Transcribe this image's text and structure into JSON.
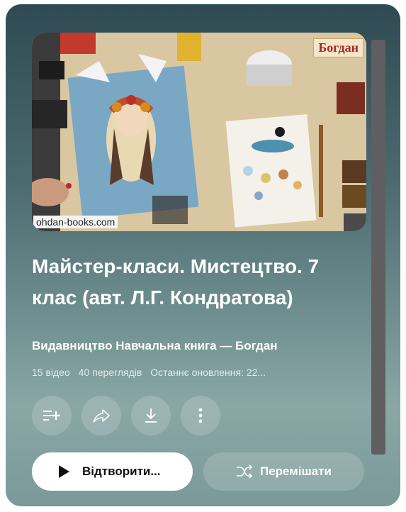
{
  "thumbnail": {
    "watermark": "ohdan-books.com",
    "logo_text": "Богдан"
  },
  "playlist": {
    "title": "Майстер-класи. Мистецтво. 7 клас (авт. Л.Г. Кондратова)",
    "channel": "Видавництво Навчальна книга — Богдан",
    "video_count": "15 відео",
    "views": "40 переглядів",
    "updated": "Останнє оновлення: 22..."
  },
  "actions": {
    "icons": [
      "add-to-queue-icon",
      "share-icon",
      "download-icon",
      "more-vert-icon"
    ],
    "play_label": "Відтворити...",
    "shuffle_label": "Перемішати"
  },
  "colors": {
    "card_gradient_top": "#2f4a52",
    "card_gradient_bottom": "#8aa7a6",
    "play_button_bg": "#ffffff",
    "text_primary": "#ffffff"
  }
}
